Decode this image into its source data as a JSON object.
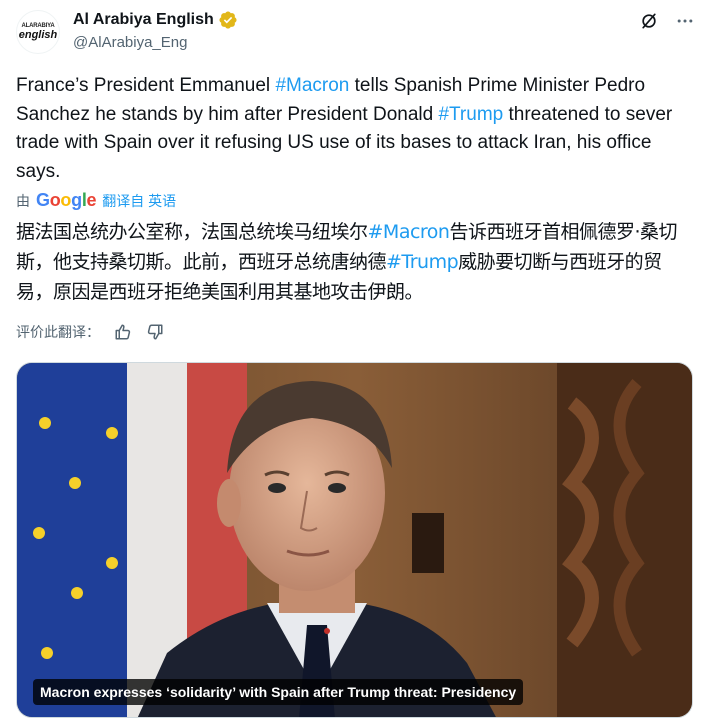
{
  "account": {
    "display_name": "Al Arabiya English",
    "handle": "@AlArabiya_Eng",
    "avatar_text_top": "ALARABIYA",
    "avatar_text_bottom": "english",
    "verified_color": "#e2b719"
  },
  "header_icons": [
    "grok-icon",
    "more-icon"
  ],
  "tweet": {
    "segments": [
      {
        "text": "France’s President Emmanuel ",
        "hashtag": false
      },
      {
        "text": "#Macron",
        "hashtag": true
      },
      {
        "text": " tells Spanish Prime Minister Pedro Sanchez he stands by him after President Donald ",
        "hashtag": false
      },
      {
        "text": "#Trump",
        "hashtag": true
      },
      {
        "text": " threatened to sever trade with Spain over it refusing US use of its bases to attack Iran, his office says.",
        "hashtag": false
      }
    ]
  },
  "translation": {
    "by_label": "由",
    "google_letters": [
      "G",
      "o",
      "o",
      "g",
      "l",
      "e"
    ],
    "link_label": "翻译自 英语",
    "segments": [
      {
        "text": "据法国总统办公室称，法国总统埃马纽埃尔",
        "hashtag": false
      },
      {
        "text": "#Macron",
        "hashtag": true
      },
      {
        "text": "告诉西班牙首相佩德罗·桑切斯，他支持桑切斯。此前，西班牙总统唐纳德",
        "hashtag": false
      },
      {
        "text": "#Trump",
        "hashtag": true
      },
      {
        "text": "威胁要切断与西班牙的贸易，原因是西班牙拒绝美国利用其基地攻击伊朗。",
        "hashtag": false
      }
    ],
    "rate_label": "评价此翻译："
  },
  "media": {
    "caption": "Macron expresses ‘solidarity’ with Spain after Trump threat: Presidency"
  },
  "colors": {
    "link": "#1d9bf0",
    "secondary_text": "#536471",
    "text": "#0f1419"
  }
}
